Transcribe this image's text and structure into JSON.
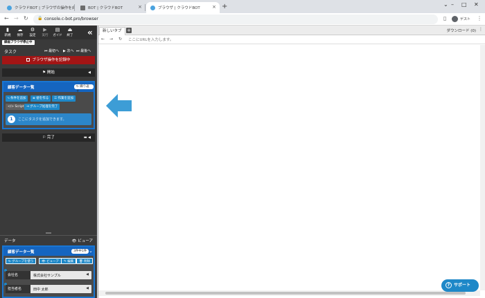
{
  "browser": {
    "tabs": [
      {
        "label": "クラウドBOT | ブラウザの操作を自動..."
      },
      {
        "label": "BOT | クラウドBOT"
      },
      {
        "label": "ブラウザ | クラウドBOT"
      }
    ],
    "url": "console.c-bot.pro/browser",
    "profile": "ゲスト"
  },
  "toolbar": {
    "items": [
      {
        "icon": "file-icon",
        "label": "新規"
      },
      {
        "icon": "cloud-save-icon",
        "label": "保存"
      },
      {
        "icon": "gear-icon",
        "label": "設定"
      },
      {
        "icon": "play-icon",
        "label": "実行"
      },
      {
        "icon": "book-icon",
        "label": "ガイド"
      },
      {
        "icon": "exit-icon",
        "label": "終了"
      }
    ],
    "status_badge": "録画ブラウザ停止中"
  },
  "task": {
    "title": "タスク",
    "jump_first": "最初へ",
    "jump_next": "次へ",
    "jump_last": "最後へ",
    "record_label": "ブラウザ操作を記録中",
    "start_label": "開始",
    "end_label": "完了"
  },
  "group": {
    "title": "顧客データ一覧",
    "loop_label": "繰り返す",
    "buttons": [
      "条件を追加",
      "値を作る",
      "作業を追加",
      "Script",
      "グループ処理を完了"
    ],
    "placeholder_num": "1",
    "placeholder_text": "ここにタスクを追加できます。"
  },
  "data": {
    "title": "データ",
    "viewer_label": "ビューア",
    "table_title": "顧客データ一覧",
    "count_badge": "3件中1件",
    "buttons": [
      "グループを使う",
      "ビューア",
      "編集",
      "削除"
    ],
    "fields": [
      {
        "label": "会社名",
        "value": "株式会社サンプル"
      },
      {
        "label": "担当者名",
        "value": "田中 太郎"
      }
    ]
  },
  "panel": {
    "tab_label": "新しいタブ",
    "download_label": "ダウンロード (0)",
    "url_placeholder": "ここにURLを入力します。"
  },
  "support": {
    "label": "サポート"
  },
  "colors": {
    "accent": "#1e88c8",
    "record": "#a31515",
    "group": "#1565c0"
  }
}
